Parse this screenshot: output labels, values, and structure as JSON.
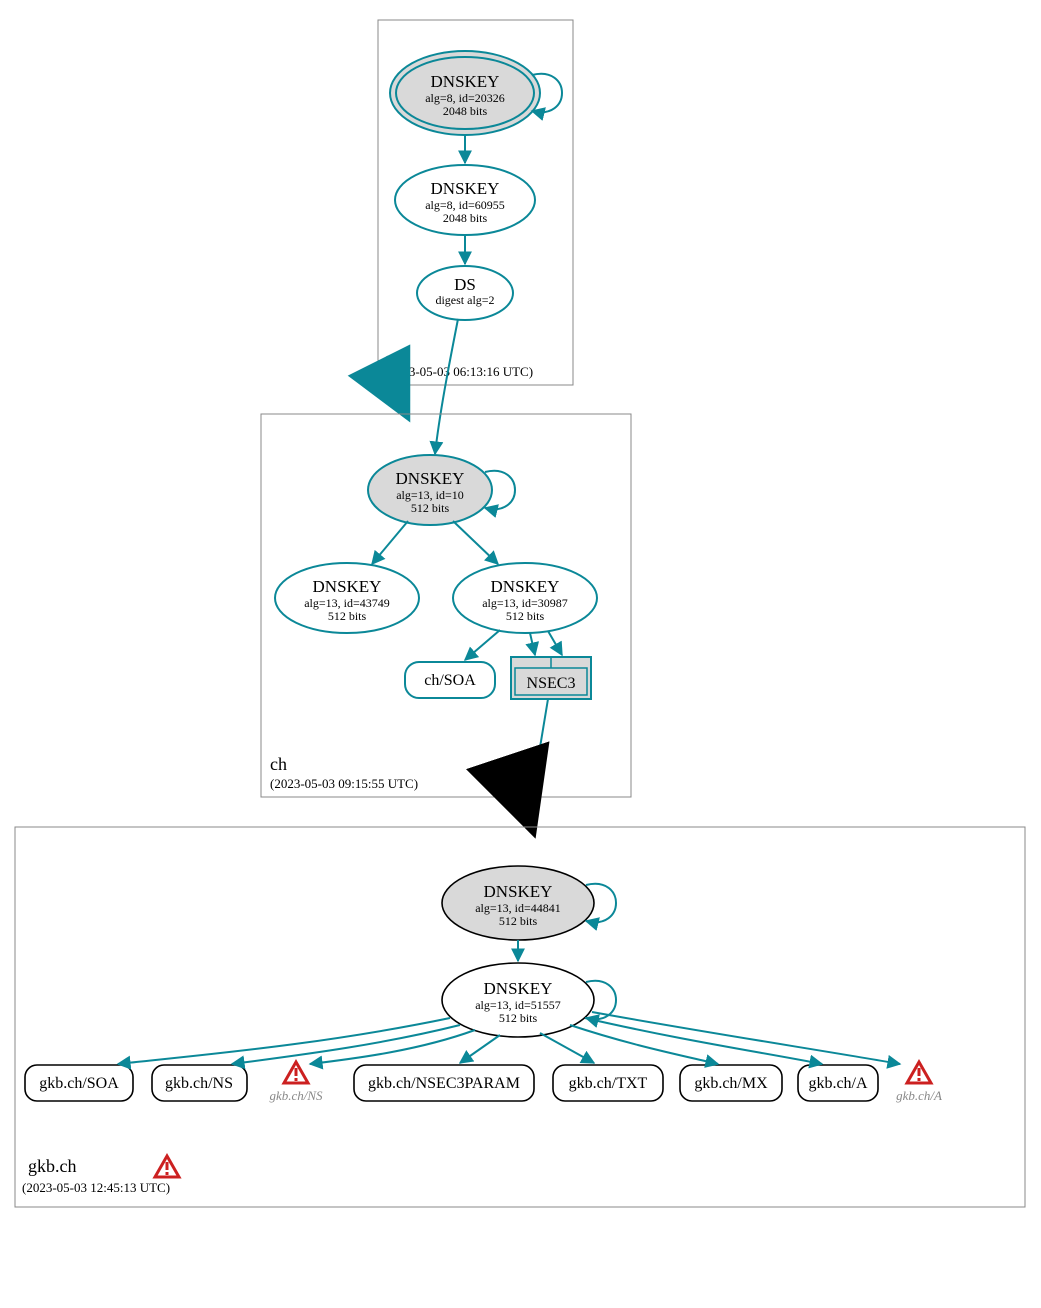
{
  "colors": {
    "teal": "#0b8898",
    "grey_fill": "#d9d9d9",
    "warn_red": "#cc2020",
    "warn_inner": "#ffffff"
  },
  "zones": {
    "root": {
      "name": ".",
      "timestamp": "(2023-05-03 06:13:16 UTC)",
      "nodes": {
        "ksk": {
          "title": "DNSKEY",
          "line1": "alg=8, id=20326",
          "line2": "2048 bits"
        },
        "zsk": {
          "title": "DNSKEY",
          "line1": "alg=8, id=60955",
          "line2": "2048 bits"
        },
        "ds": {
          "title": "DS",
          "line1": "digest alg=2"
        }
      }
    },
    "ch": {
      "name": "ch",
      "timestamp": "(2023-05-03 09:15:55 UTC)",
      "nodes": {
        "ksk": {
          "title": "DNSKEY",
          "line1": "alg=13, id=10",
          "line2": "512 bits"
        },
        "zsk1": {
          "title": "DNSKEY",
          "line1": "alg=13, id=43749",
          "line2": "512 bits"
        },
        "zsk2": {
          "title": "DNSKEY",
          "line1": "alg=13, id=30987",
          "line2": "512 bits"
        },
        "soa": {
          "label": "ch/SOA"
        },
        "nsec3": {
          "label": "NSEC3"
        }
      }
    },
    "gkb": {
      "name": "gkb.ch",
      "timestamp": "(2023-05-03 12:45:13 UTC)",
      "nodes": {
        "ksk": {
          "title": "DNSKEY",
          "line1": "alg=13, id=44841",
          "line2": "512 bits"
        },
        "zsk": {
          "title": "DNSKEY",
          "line1": "alg=13, id=51557",
          "line2": "512 bits"
        }
      },
      "rrsets": {
        "soa": "gkb.ch/SOA",
        "ns": "gkb.ch/NS",
        "nsec3param": "gkb.ch/NSEC3PARAM",
        "txt": "gkb.ch/TXT",
        "mx": "gkb.ch/MX",
        "a": "gkb.ch/A"
      },
      "warnings": {
        "ns": "gkb.ch/NS",
        "a": "gkb.ch/A"
      }
    }
  }
}
